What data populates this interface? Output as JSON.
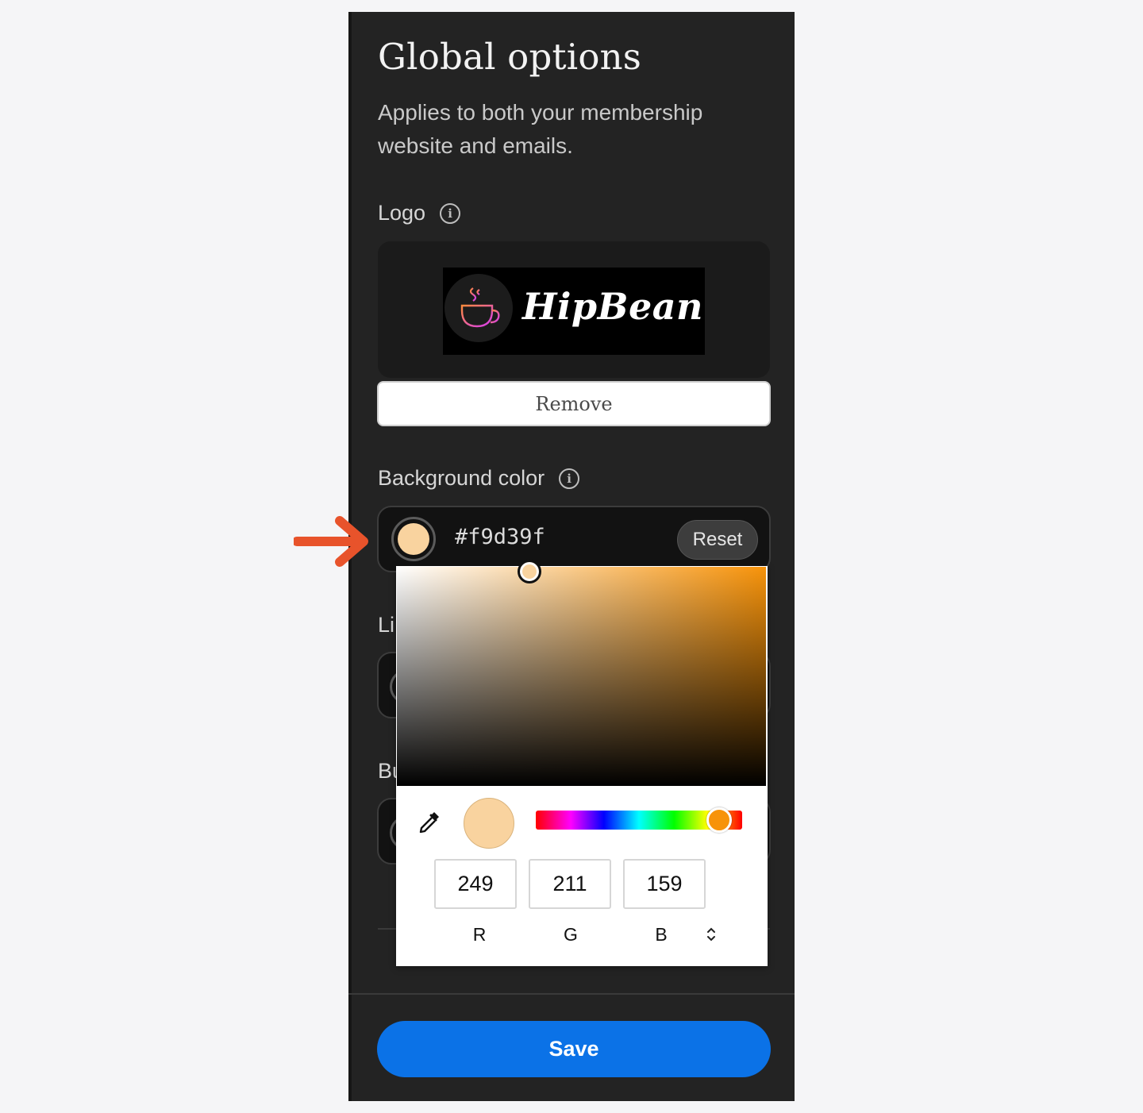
{
  "panel": {
    "title": "Global options",
    "subtitle": "Applies to both your membership website and emails."
  },
  "logo_section": {
    "label": "Logo",
    "logo_text": "HipBean",
    "remove_label": "Remove"
  },
  "background_color": {
    "label": "Background color",
    "value": "#f9d39f",
    "reset_label": "Reset"
  },
  "partially_hidden": {
    "link_color_label_fragment": "Li",
    "button_color_label_fragment": "Bu"
  },
  "color_picker": {
    "r": "249",
    "g": "211",
    "b": "159",
    "r_label": "R",
    "g_label": "G",
    "b_label": "B",
    "mode_toggle_icon": "chevron-up-down-icon",
    "eyedropper_icon": "eyedropper-icon",
    "hue_color": "#f7930a",
    "current_color": "#f9d39f",
    "saturation": 0.36,
    "value": 0.98,
    "hue_position": 0.89
  },
  "footer": {
    "save_label": "Save"
  },
  "annotation": {
    "arrow_color": "#e8532b"
  }
}
